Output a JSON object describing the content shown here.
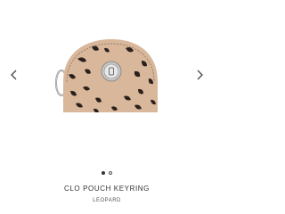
{
  "product": {
    "title": "CLO POUCH KEYRING",
    "variant": "LEOPARD"
  },
  "carousel": {
    "prev_icon": "chevron-left-icon",
    "next_icon": "chevron-right-icon",
    "slide_count": 2,
    "active_index": 0
  },
  "colors": {
    "text": "#333333",
    "pouch_base": "#d9b79a",
    "spots": "#2a211c",
    "clasp_metal": "#c8c8c8"
  }
}
